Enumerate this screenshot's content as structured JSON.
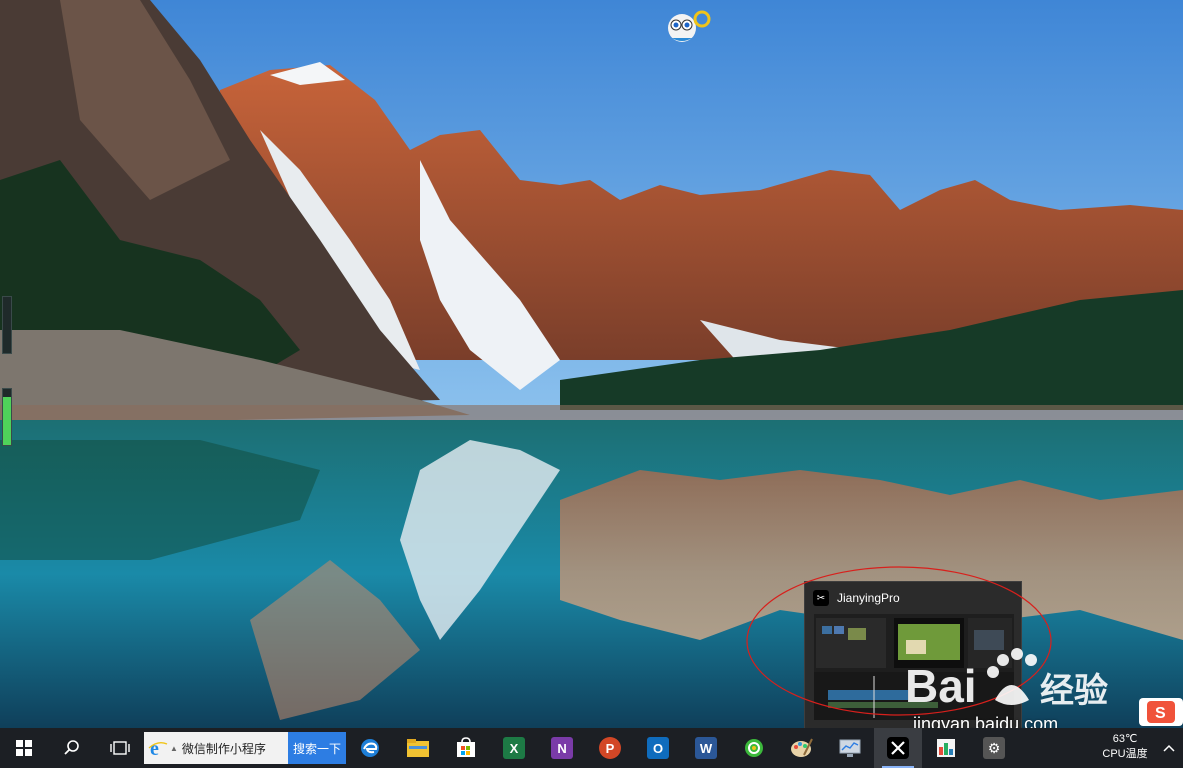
{
  "taskbar": {
    "search_placeholder": "微信制作小程序",
    "search_button": "搜索一下",
    "apps": [
      {
        "name": "edge-icon",
        "running": false
      },
      {
        "name": "file-explorer-icon",
        "running": false
      },
      {
        "name": "store-icon",
        "running": false
      },
      {
        "name": "excel-icon",
        "running": false
      },
      {
        "name": "onenote-icon",
        "running": false
      },
      {
        "name": "powerpoint-icon",
        "running": false
      },
      {
        "name": "outlook-icon",
        "running": false
      },
      {
        "name": "word-icon",
        "running": false
      },
      {
        "name": "browser-360-icon",
        "running": false
      },
      {
        "name": "paint-icon",
        "running": false
      },
      {
        "name": "monitor-icon",
        "running": false
      },
      {
        "name": "jianying-icon",
        "running": true
      },
      {
        "name": "chart-app-icon",
        "running": false
      },
      {
        "name": "settings-icon",
        "running": false
      }
    ],
    "tray": {
      "temperature": "63℃",
      "cpu_label": "CPU温度"
    }
  },
  "preview": {
    "title": "JianyingPro"
  },
  "widgets": {
    "gauge_top_level": 0.0,
    "gauge_bottom_level": 0.85
  },
  "watermark": {
    "logo_text": "Bai经验",
    "url": "jingyan.baidu.com"
  },
  "colors": {
    "taskbar": "#1c1f24",
    "search_button": "#2d7de3",
    "annotation_red": "#d8201c",
    "gauge_fill": "#4fd25a"
  }
}
